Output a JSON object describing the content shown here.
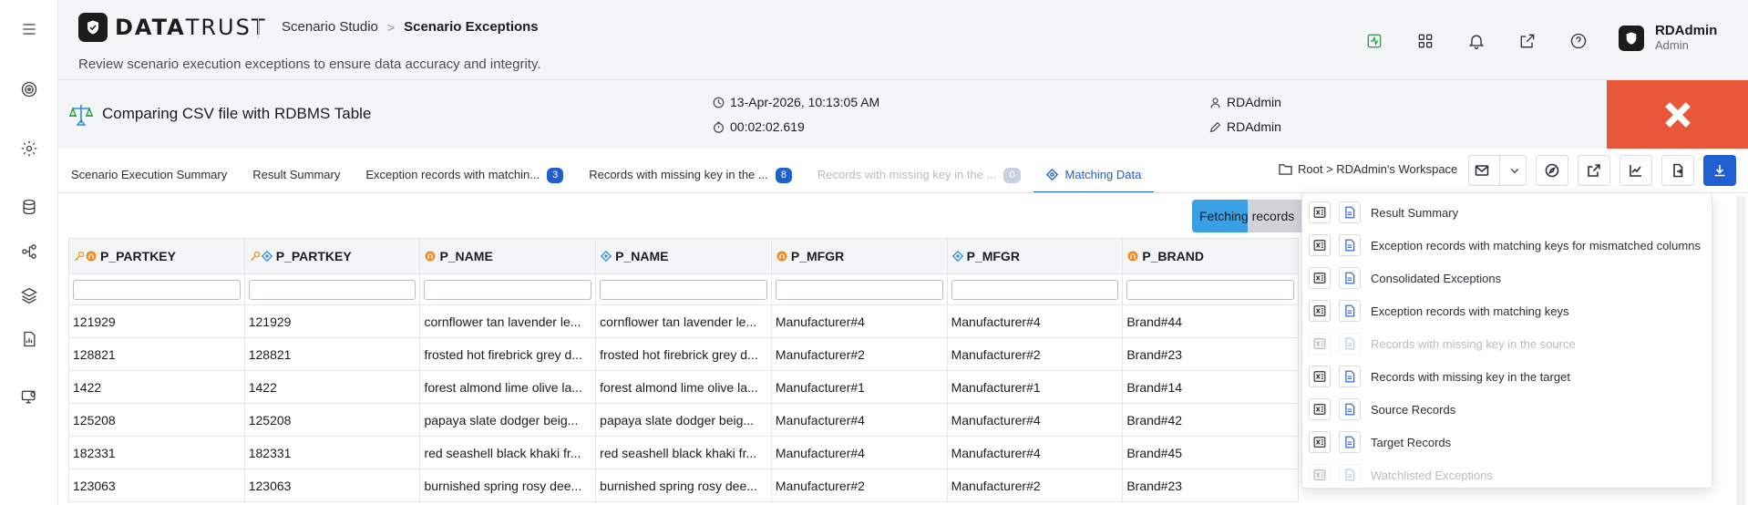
{
  "app": {
    "brand": "DATATRUST",
    "breadcrumb": [
      "Scenario Studio",
      "Scenario Exceptions"
    ],
    "subtitle": "Review scenario execution exceptions to ensure data accuracy and integrity."
  },
  "user": {
    "name": "RDAdmin",
    "role": "Admin"
  },
  "scenario": {
    "title": "Comparing CSV file with RDBMS Table",
    "datetime": "13-Apr-2026, 10:13:05 AM",
    "duration": "00:02:02.619",
    "owner": "RDAdmin",
    "modified_by": "RDAdmin"
  },
  "tabs": [
    {
      "label": "Scenario Execution Summary"
    },
    {
      "label": "Result Summary"
    },
    {
      "label": "Exception records with matchin...",
      "count": "3"
    },
    {
      "label": "Records with missing key in the ...",
      "count": "8"
    },
    {
      "label": "Records with missing key in the ...",
      "count": "0"
    },
    {
      "label": "Matching Data"
    }
  ],
  "workspace": {
    "path": "Root > RDAdmin's Workspace"
  },
  "fetching": {
    "label": "Fetching records",
    "progress": 0.49
  },
  "grid": {
    "columns": [
      {
        "label": "P_PARTKEY",
        "icons": [
          "key-icon",
          "source-icon"
        ]
      },
      {
        "label": "P_PARTKEY",
        "icons": [
          "key-icon",
          "target-icon"
        ]
      },
      {
        "label": "P_NAME",
        "icons": [
          "source-icon"
        ]
      },
      {
        "label": "P_NAME",
        "icons": [
          "target-icon"
        ]
      },
      {
        "label": "P_MFGR",
        "icons": [
          "source-icon"
        ]
      },
      {
        "label": "P_MFGR",
        "icons": [
          "target-icon"
        ]
      },
      {
        "label": "P_BRAND",
        "icons": [
          "source-icon"
        ]
      }
    ],
    "rows": [
      [
        "121929",
        "121929",
        "cornflower tan lavender le...",
        "cornflower tan lavender le...",
        "Manufacturer#4",
        "Manufacturer#4",
        "Brand#44"
      ],
      [
        "128821",
        "128821",
        "frosted hot firebrick grey d...",
        "frosted hot firebrick grey d...",
        "Manufacturer#2",
        "Manufacturer#2",
        "Brand#23"
      ],
      [
        "1422",
        "1422",
        "forest almond lime olive la...",
        "forest almond lime olive la...",
        "Manufacturer#1",
        "Manufacturer#1",
        "Brand#14"
      ],
      [
        "125208",
        "125208",
        "papaya slate dodger beig...",
        "papaya slate dodger beig...",
        "Manufacturer#4",
        "Manufacturer#4",
        "Brand#42"
      ],
      [
        "182331",
        "182331",
        "red seashell black khaki fr...",
        "red seashell black khaki fr...",
        "Manufacturer#4",
        "Manufacturer#4",
        "Brand#45"
      ],
      [
        "123063",
        "123063",
        "burnished spring rosy dee...",
        "burnished spring rosy dee...",
        "Manufacturer#2",
        "Manufacturer#2",
        "Brand#23"
      ]
    ]
  },
  "download_menu": [
    {
      "label": "Result Summary",
      "enabled": true
    },
    {
      "label": "Exception records with matching keys for mismatched columns",
      "enabled": true
    },
    {
      "label": "Consolidated Exceptions",
      "enabled": true
    },
    {
      "label": "Exception records with matching keys",
      "enabled": true
    },
    {
      "label": "Records with missing key in the source",
      "enabled": false
    },
    {
      "label": "Records with missing key in the target",
      "enabled": true
    },
    {
      "label": "Source Records",
      "enabled": true
    },
    {
      "label": "Target Records",
      "enabled": true
    },
    {
      "label": "Watchlisted Exceptions",
      "enabled": false
    }
  ],
  "colors": {
    "accent": "#1f5fd0",
    "close": "#e8573a",
    "source": "#f08a24",
    "target": "#2a8fd6",
    "progress": "#3aa0e6"
  }
}
